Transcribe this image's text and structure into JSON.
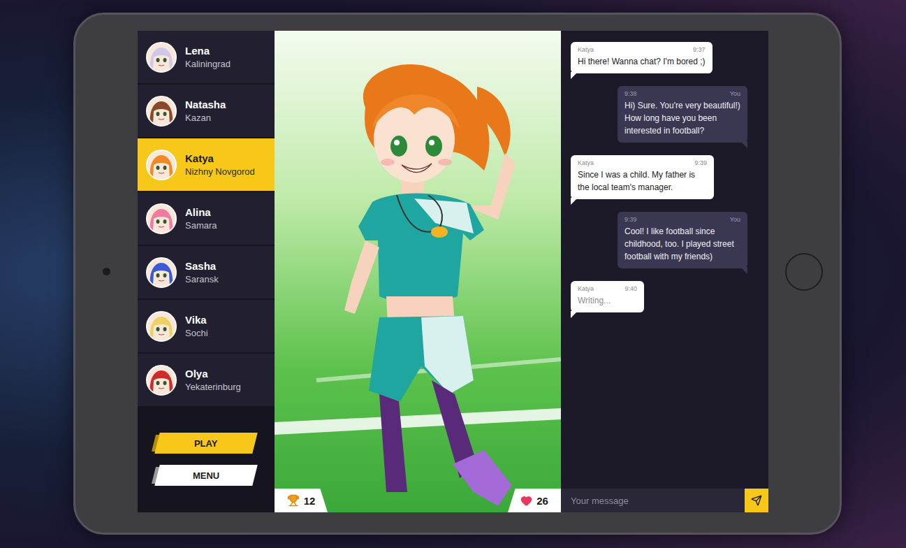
{
  "contacts": [
    {
      "name": "Lena",
      "city": "Kaliningrad",
      "selected": false,
      "color": "#cfc8ea"
    },
    {
      "name": "Natasha",
      "city": "Kazan",
      "selected": false,
      "color": "#8a4a2a"
    },
    {
      "name": "Katya",
      "city": "Nizhny Novgorod",
      "selected": true,
      "color": "#f08a24"
    },
    {
      "name": "Alina",
      "city": "Samara",
      "selected": false,
      "color": "#f07aa0"
    },
    {
      "name": "Sasha",
      "city": "Saransk",
      "selected": false,
      "color": "#3b5bd6"
    },
    {
      "name": "Vika",
      "city": "Sochi",
      "selected": false,
      "color": "#f0d060"
    },
    {
      "name": "Olya",
      "city": "Yekaterinburg",
      "selected": false,
      "color": "#d02a2a"
    }
  ],
  "buttons": [
    {
      "label": "PLAY",
      "primary": true
    },
    {
      "label": "MENU",
      "primary": false
    }
  ],
  "profile": {
    "trophies": "12",
    "likes": "26"
  },
  "messages": [
    {
      "sender": "Katya",
      "time": "9:37",
      "text": "Hi there! Wanna chat? I'm bored ;)",
      "outgoing": false,
      "typing": false
    },
    {
      "sender": "You",
      "time": "9:38",
      "text": "Hi) Sure. You're very beautiful!) How long have you been interested in football?",
      "outgoing": true,
      "typing": false
    },
    {
      "sender": "Katya",
      "time": "9:39",
      "text": "Since I was a child. My father is the local team's manager.",
      "outgoing": false,
      "typing": false
    },
    {
      "sender": "You",
      "time": "9:39",
      "text": "Cool! I like football since childhood, too. I played street football with my friends)",
      "outgoing": true,
      "typing": false
    },
    {
      "sender": "Katya",
      "time": "9:40",
      "text": "Writing...",
      "outgoing": false,
      "typing": true
    }
  ],
  "composer": {
    "placeholder": "Your message"
  }
}
